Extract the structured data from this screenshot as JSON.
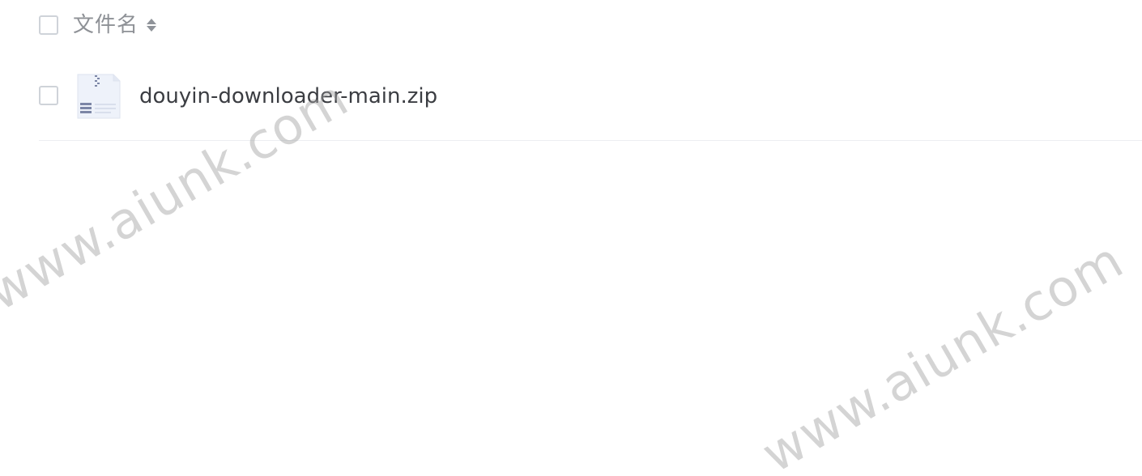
{
  "table": {
    "header": {
      "name_label": "文件名",
      "sort_icon": "sort-toggle-icon"
    },
    "rows": [
      {
        "name": "douyin-downloader-main.zip",
        "icon": "zip-file-icon"
      }
    ]
  },
  "watermarks": [
    "www.aiunk.com",
    "www.aiunk.com"
  ],
  "colors": {
    "header_text": "#8e9196",
    "file_text": "#3b3d42",
    "border": "#cfd3d9",
    "divider": "#eceef2",
    "zip_icon_bg": "#eef2fa",
    "zip_icon_accent": "#7c86a6"
  }
}
